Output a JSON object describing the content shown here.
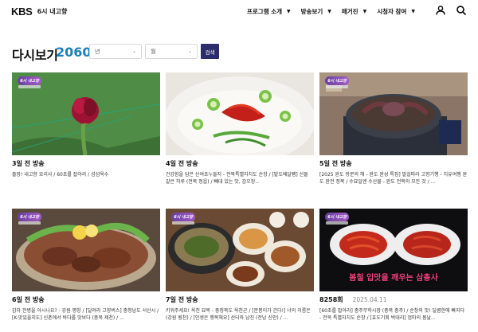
{
  "header": {
    "brand": "KBS",
    "program": "6시 내고향",
    "nav": [
      {
        "label": "프로그램 소개"
      },
      {
        "label": "방송보기"
      },
      {
        "label": "매거진"
      },
      {
        "label": "시청자 참여"
      }
    ],
    "icons": [
      "user-icon",
      "search-icon"
    ]
  },
  "page": {
    "title": "다시보기",
    "count": "2060"
  },
  "filters": {
    "year_placeholder": "년",
    "month_placeholder": "월",
    "search_label": "검색"
  },
  "badge_text": "6시 내고향",
  "cards": [
    {
      "ep": "3일 전 방송",
      "date": "",
      "desc": "출장! 내고향 요리사 / 60초를 잡아라 / 섬섬옥수",
      "thumb": "flower"
    },
    {
      "ep": "4일 전 방송",
      "date": "",
      "desc": "건강함을 담은 산여초누들지 - 전북특별자치도 순창 / [밭도배달팸] 선물 같은 하루 (전북 정읍) / 빼대 있는 맛, 갑오징...",
      "thumb": "soup"
    },
    {
      "ep": "5일 전 방송",
      "date": "",
      "desc": "[2025 완도 방문의 해 - 완도 완성 특집] 발걸따라 고향기행 - 치유여행 완도 완전 정복 / 수묘일엔 수산물 - 완도 전복의 모든 것 / ...",
      "thumb": "octopus"
    },
    {
      "ep": "6일 전 방송",
      "date": "",
      "desc": "감자 전병을 아시나요? - 강원 평창 / [달려라 고향버스] 충청남도 서산시 / [K-맛있을지도] 신촌에서 바다를 맛보다 (충북 제천) / ...",
      "thumb": "platter"
    },
    {
      "ep": "7일 전 방송",
      "date": "",
      "desc": "키워주세요! 옥천 묘목 - 충청북도 옥천군 / [분봉이가 간다!] 너의 이름은 (강원 횡천) / [인생은 행복해요] 산터와 남진 (전남 신안) / ...",
      "thumb": "table"
    },
    {
      "ep": "8258회",
      "date": "2025.04.11",
      "desc": "[60초를 잡아라] 충주무학시장 (충북 충주) / 순창의 맛! 달콤한에 빠지다 - 전북 특별자치도 순창 / [효도기획 박대리] 엄마의 봄날...",
      "thumb": "squid",
      "caption": "봄철 입맛을 깨우는 삼총사"
    }
  ],
  "colors": {
    "accent": "#1c7fb8",
    "button": "#2b2c6b",
    "caption": "#f0447e"
  }
}
